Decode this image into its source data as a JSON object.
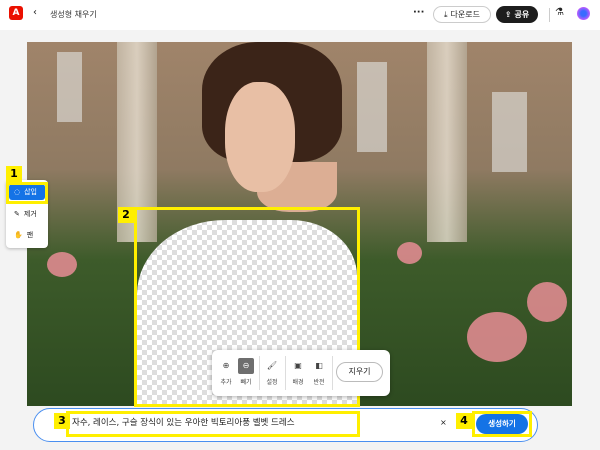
{
  "header": {
    "title": "생성형 채우기",
    "download_label": "다운로드",
    "share_label": "공유"
  },
  "toolbar": {
    "items": [
      {
        "label": "삽입",
        "active": true
      },
      {
        "label": "제거"
      },
      {
        "label": "팬"
      }
    ]
  },
  "context_bar": {
    "items": [
      {
        "label": "추가"
      },
      {
        "label": "빼기",
        "active": true
      },
      {
        "label": "설정"
      },
      {
        "label": "배경"
      },
      {
        "label": "반전"
      }
    ],
    "erase_label": "지우기"
  },
  "prompt": {
    "value": "자수, 레이스, 구슬 장식이 있는 우아한 빅토리아풍 벨벳 드레스",
    "clear": "×",
    "generate_label": "생성하기"
  },
  "annotations": [
    "1",
    "2",
    "3",
    "4"
  ],
  "colors": {
    "accent": "#1473e6",
    "highlight": "#ffef00",
    "brand": "#eb1000"
  }
}
